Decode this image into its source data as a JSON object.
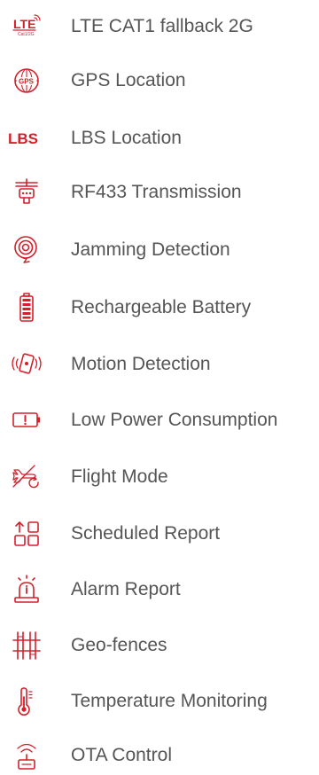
{
  "features": [
    {
      "label": "LTE CAT1 fallback 2G",
      "icon": "lte-icon",
      "icon_text": "LTE",
      "icon_subtext": "Cat1/2G"
    },
    {
      "label": "GPS Location",
      "icon": "gps-globe-icon",
      "icon_text": "GPS"
    },
    {
      "label": "LBS Location",
      "icon": "lbs-icon",
      "icon_text": "LBS"
    },
    {
      "label": "RF433 Transmission",
      "icon": "rf-antenna-icon"
    },
    {
      "label": "Jamming Detection",
      "icon": "jamming-signal-icon"
    },
    {
      "label": "Rechargeable Battery",
      "icon": "battery-icon"
    },
    {
      "label": "Motion Detection",
      "icon": "vibration-motion-icon"
    },
    {
      "label": "Low Power Consumption",
      "icon": "low-battery-icon"
    },
    {
      "label": "Flight Mode",
      "icon": "airplane-icon"
    },
    {
      "label": "Scheduled Report",
      "icon": "schedule-grid-icon"
    },
    {
      "label": "Alarm Report",
      "icon": "alarm-light-icon"
    },
    {
      "label": "Geo-fences",
      "icon": "geo-fence-icon"
    },
    {
      "label": "Temperature Monitoring",
      "icon": "thermometer-icon"
    },
    {
      "label": "OTA Control",
      "icon": "ota-wireless-icon"
    }
  ],
  "colors": {
    "icon_accent": "#d4202a",
    "label_text": "#555555",
    "background": "#ffffff"
  }
}
